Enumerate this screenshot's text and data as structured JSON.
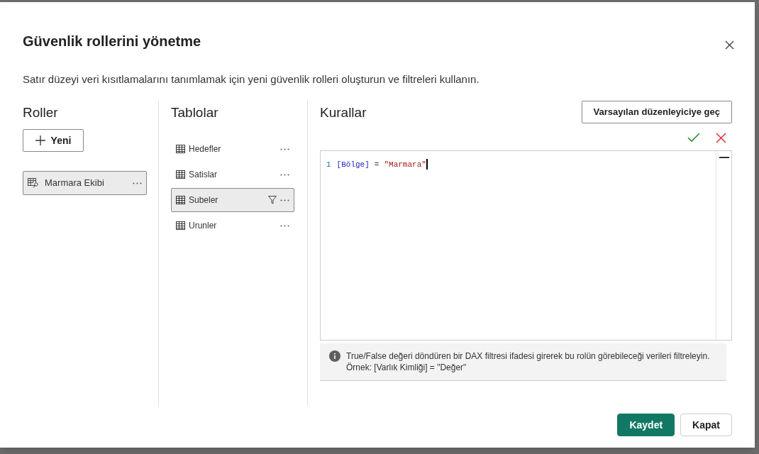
{
  "dialog": {
    "title": "Güvenlik rollerini yönetme",
    "description": "Satır düzeyi veri kısıtlamalarını tanımlamak için yeni güvenlik rolleri oluşturun ve filtreleri kullanın."
  },
  "roles": {
    "heading": "Roller",
    "new_button": "Yeni",
    "items": [
      {
        "name": "Marmara Ekibi",
        "selected": true
      }
    ]
  },
  "tables": {
    "heading": "Tablolar",
    "items": [
      {
        "name": "Hedefler",
        "selected": false,
        "filtered": false
      },
      {
        "name": "Satislar",
        "selected": false,
        "filtered": false
      },
      {
        "name": "Subeler",
        "selected": true,
        "filtered": true
      },
      {
        "name": "Urunler",
        "selected": false,
        "filtered": false
      }
    ]
  },
  "rules": {
    "heading": "Kurallar",
    "switch_button": "Varsayılan düzenleyiciye geç",
    "editor": {
      "lines": [
        {
          "number": "1",
          "tokens": [
            {
              "kind": "field",
              "text": "[Bölge]"
            },
            {
              "kind": "operator",
              "text": "="
            },
            {
              "kind": "string",
              "text": "\"Marmara\""
            }
          ]
        }
      ]
    },
    "hint": [
      "True/False değeri döndüren bir DAX filtresi ifadesi girerek bu rolün görebileceği verileri filtreleyin.",
      "Örnek: [Varlık Kimliği] = \"Değer\""
    ]
  },
  "buttons": [
    {
      "label": "Kaydet",
      "kind": "primary"
    },
    {
      "label": "Kapat",
      "kind": "secondary"
    }
  ]
}
